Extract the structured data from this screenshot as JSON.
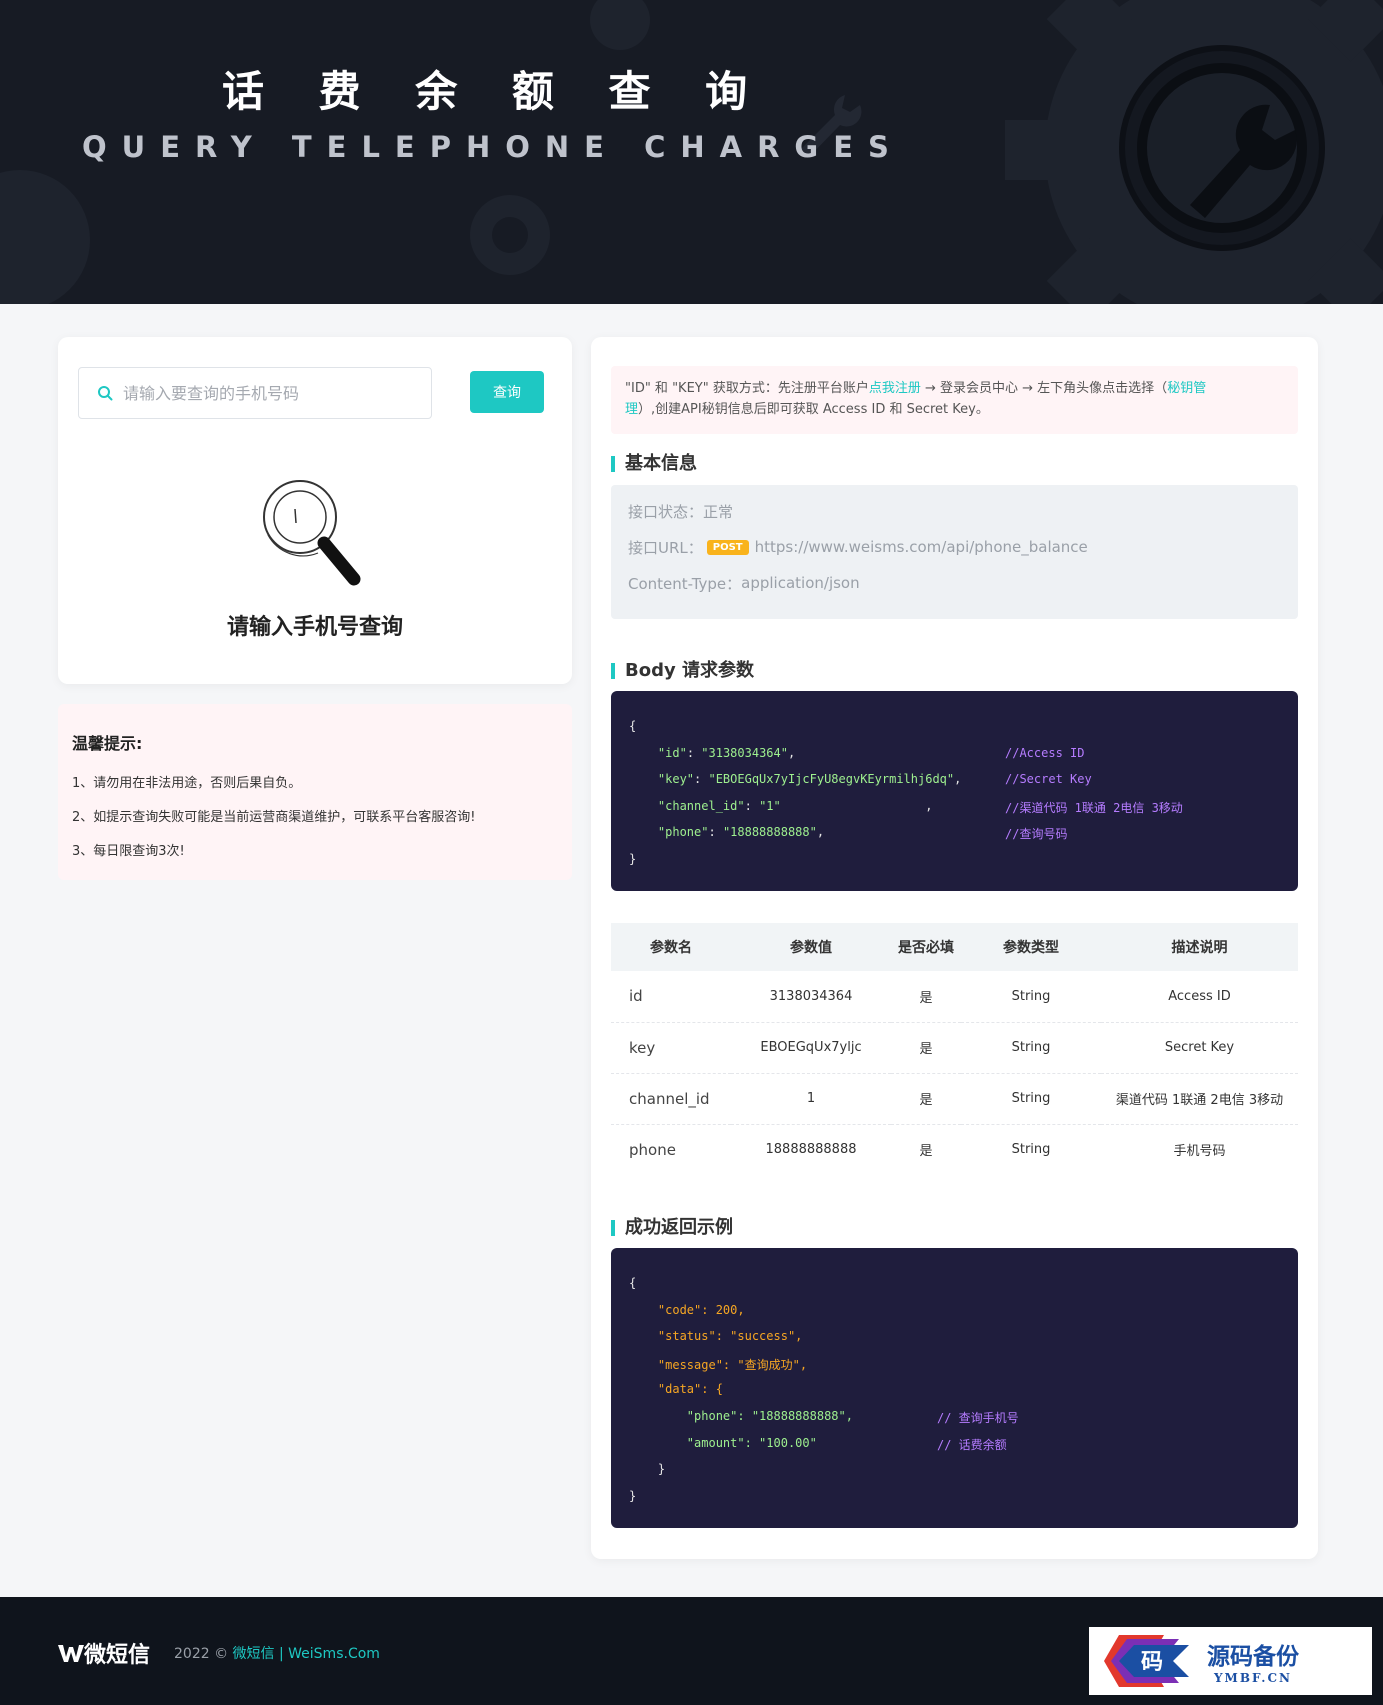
{
  "header": {
    "title": "话 费 余 额 查 询",
    "subtitle": "QUERY TELEPHONE CHARGES"
  },
  "search": {
    "placeholder": "请输入要查询的手机号码",
    "button_label": "查询",
    "empty_text": "请输入手机号查询"
  },
  "tips": {
    "title": "温馨提示:",
    "items": [
      "1、请勿用在非法用途，否则后果自负。",
      "2、如提示查询失败可能是当前运营商渠道维护，可联系平台客服咨询!",
      "3、每日限查询3次!"
    ]
  },
  "notice": {
    "prefix": "\"ID\" 和 \"KEY\" 获取方式：先注册平台账户",
    "register_link": "点我注册",
    "middle": " → 登录会员中心 → 左下角头像点击选择（",
    "key_link_a": "秘钥管",
    "key_link_b": "理",
    "suffix": "）,创建API秘钥信息后即可获取 Access ID 和 Secret Key。"
  },
  "basic_info": {
    "section_title": "基本信息",
    "status_label": "接口状态：",
    "status_value": "正常",
    "url_label": "接口URL：",
    "method_badge": "POST",
    "url_value": "https://www.weisms.com/api/phone_balance",
    "content_type_label": "Content-Type：",
    "content_type_value": "application/json"
  },
  "body_params": {
    "section_title": "Body 请求参数",
    "lines": [
      {
        "indent": 0,
        "text": "{",
        "comment": ""
      },
      {
        "indent": 1,
        "key": "\"id\"",
        "value": "\"3138034364\"",
        "tail": ",",
        "comment": "//Access ID"
      },
      {
        "indent": 1,
        "key": "\"key\"",
        "value": "\"EBOEGqUx7yIjcFyU8egvKEyrmilhj6dq\"",
        "tail": ",",
        "comment": "//Secret Key"
      },
      {
        "indent": 1,
        "key": "\"channel_id\"",
        "value": "\"1\"",
        "tail": "                    ,",
        "comment": "//渠道代码 1联通 2电信 3移动"
      },
      {
        "indent": 1,
        "key": "\"phone\"",
        "value": "\"18888888888\"",
        "tail": ",",
        "comment": "//查询号码"
      },
      {
        "indent": 0,
        "text": "}",
        "comment": ""
      }
    ]
  },
  "param_table": {
    "headers": [
      "参数名",
      "参数值",
      "是否必填",
      "参数类型",
      "描述说明"
    ],
    "rows": [
      [
        "id",
        "3138034364",
        "是",
        "String",
        "Access ID"
      ],
      [
        "key",
        "EBOEGqUx7yljc",
        "是",
        "String",
        "Secret Key"
      ],
      [
        "channel_id",
        "1",
        "是",
        "String",
        "渠道代码 1联通 2电信 3移动"
      ],
      [
        "phone",
        "18888888888",
        "是",
        "String",
        "手机号码"
      ]
    ]
  },
  "success_example": {
    "section_title": "成功返回示例",
    "lines": [
      "{",
      "    \"code\": 200,",
      "    \"status\": \"success\",",
      "    \"message\": \"查询成功\",",
      "    \"data\": {",
      "        \"phone\": \"18888888888\",",
      "        \"amount\": \"100.00\"",
      "    }",
      "}"
    ],
    "comments": {
      "phone": "// 查询手机号",
      "amount": "// 话费余额"
    }
  },
  "footer": {
    "logo_text": "微短信",
    "copyright_prefix": "2022 © ",
    "brand_link": "微短信 | WeiSms.Com"
  },
  "watermark": {
    "badge": "码",
    "main": "源码备份",
    "sub": "YMBF.CN"
  },
  "colors": {
    "accent": "#1ec8c3",
    "header_bg": "#171b24",
    "code_bg": "#1f1d3d",
    "badge": "#f9b31c"
  }
}
